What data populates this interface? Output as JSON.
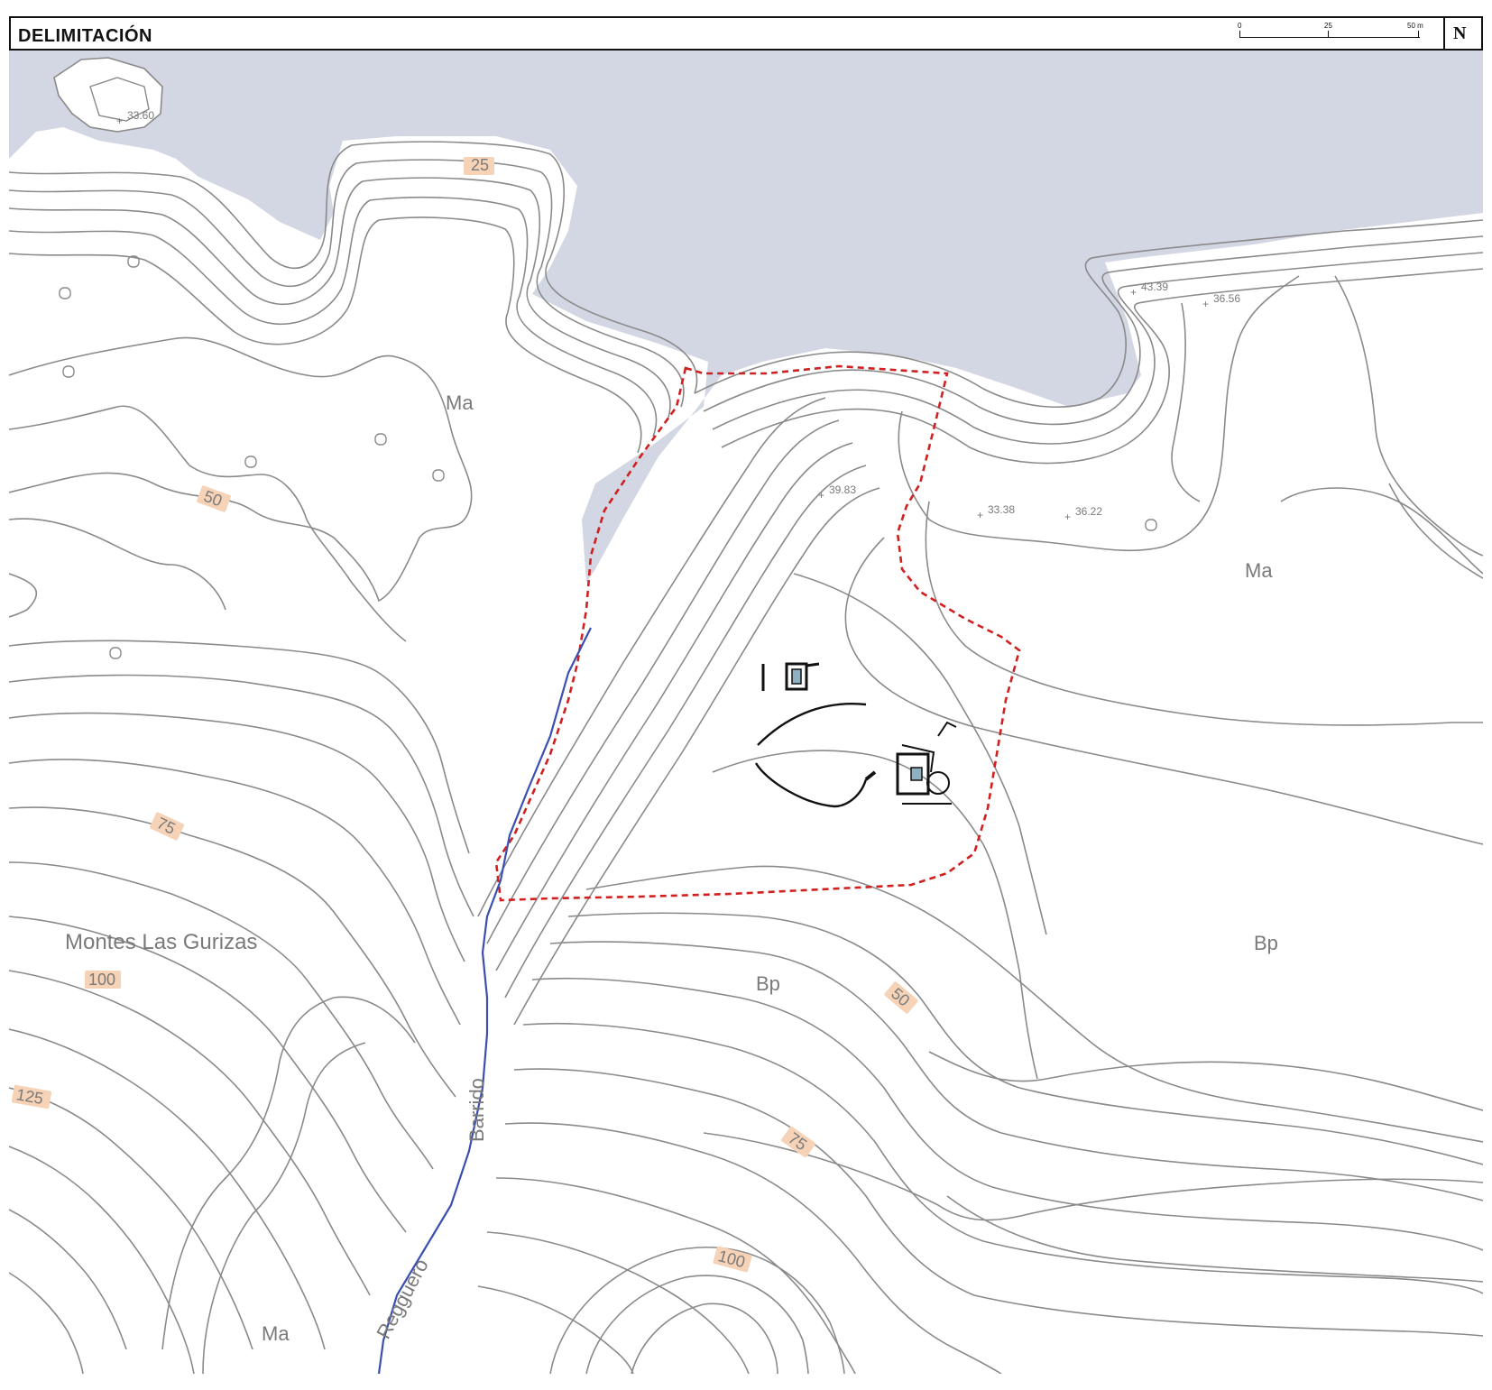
{
  "header": {
    "title": "DELIMITACIÓN",
    "scale_labels": [
      "0",
      "25",
      "50 m"
    ],
    "north_label": "N"
  },
  "colors": {
    "sea": "#d3d6e3",
    "contour": "#8a8a8a",
    "boundary": "#d02020",
    "stream": "#3a4fb0",
    "label_bg": "#f6d2b6"
  },
  "map": {
    "place_name": "Montes Las Gurizas",
    "stream_name_1": "Barrido",
    "stream_name_2": "Regguero",
    "units": {
      "ma_1": "Ma",
      "ma_2": "Ma",
      "ma_3": "Ma",
      "bp_1": "Bp",
      "bp_2": "Bp"
    },
    "contour_labels": {
      "c25": "25",
      "c50a": "50",
      "c50b": "50",
      "c75a": "75",
      "c75b": "75",
      "c100a": "100",
      "c100b": "100",
      "c125": "125"
    },
    "spot_heights": {
      "h1": "33.60",
      "h2": "39.83",
      "h3": "33.38",
      "h4": "36.22",
      "h5": "43.39",
      "h6": "36.56"
    }
  }
}
